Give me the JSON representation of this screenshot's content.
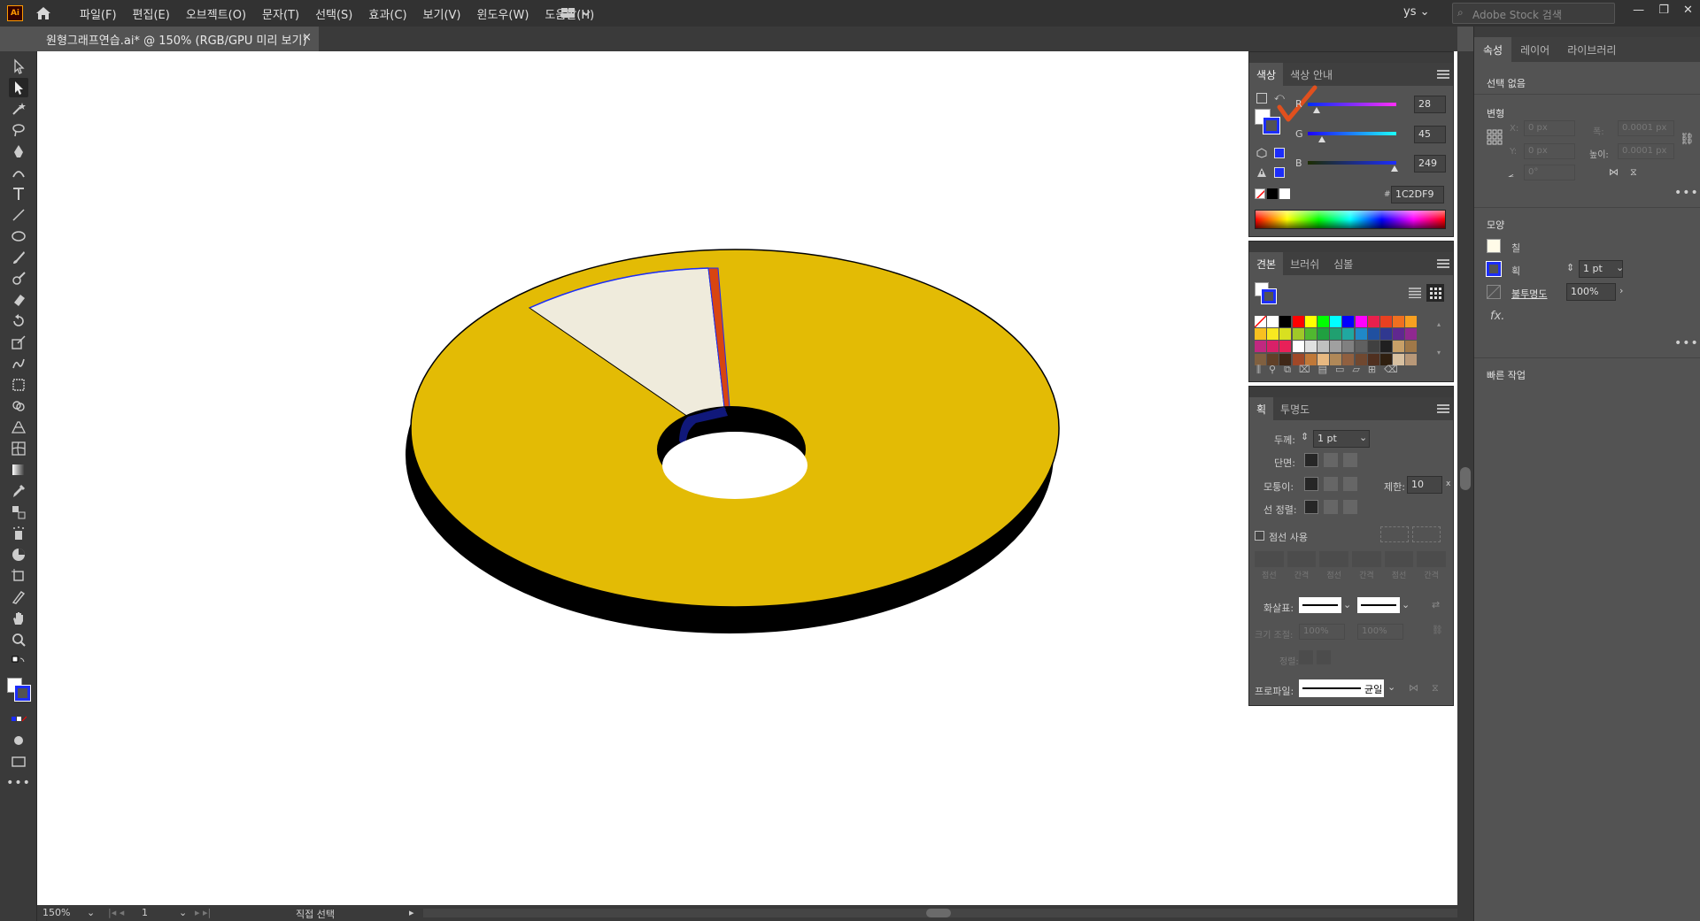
{
  "app": {
    "logo": "Ai",
    "menus": [
      "파일(F)",
      "편집(E)",
      "오브젝트(O)",
      "문자(T)",
      "선택(S)",
      "효과(C)",
      "보기(V)",
      "윈도우(W)",
      "도움말(H)"
    ],
    "user": "ys",
    "search_placeholder": "Adobe Stock 검색",
    "window_buttons": [
      "—",
      "❐",
      "✕"
    ]
  },
  "document_tab": {
    "title": "원형그래프연습.ai* @ 150% (RGB/GPU 미리 보기)",
    "close": "×"
  },
  "status_bar": {
    "zoom": "150%",
    "page": "1",
    "status": "직접 선택"
  },
  "color_panel": {
    "tabs": [
      "색상",
      "색상 안내"
    ],
    "channels": [
      {
        "label": "R",
        "value": "28"
      },
      {
        "label": "G",
        "value": "45"
      },
      {
        "label": "B",
        "value": "249"
      }
    ],
    "hex_label": "#",
    "hex": "1C2DF9",
    "annotation_color": "#e0501e"
  },
  "swatches_panel": {
    "tabs": [
      "견본",
      "브러쉬",
      "심볼"
    ],
    "colors": [
      "#ffffff",
      "#ffffff",
      "#000000",
      "#ff0000",
      "#ffff00",
      "#00ff00",
      "#00ffff",
      "#0000ff",
      "#ff00ff",
      "#e8204c",
      "#e84020",
      "#f07020",
      "#f8a020",
      "#f8c020",
      "#f8e820",
      "#d8e020",
      "#a0c828",
      "#50b830",
      "#20a040",
      "#20a070",
      "#20a8a0",
      "#2088c8",
      "#2050a0",
      "#303890",
      "#602890",
      "#902890",
      "#c02880",
      "#d82068",
      "#e82058",
      "#ffffff",
      "#e0e0e0",
      "#c0c0c0",
      "#a0a0a0",
      "#808080",
      "#606060",
      "#404040",
      "#202020",
      "#c8a068",
      "#a07848",
      "#806040",
      "#604028",
      "#402818",
      "#a04828",
      "#c07838",
      "#e8b880",
      "#b08858",
      "#906040",
      "#704830",
      "#503020",
      "#302010",
      "#d8c0a0",
      "#b89878"
    ]
  },
  "stroke_panel": {
    "tabs": [
      "획",
      "투명도"
    ],
    "weight_label": "두께:",
    "weight": "1 pt",
    "cap_label": "단면:",
    "corner_label": "모퉁이:",
    "limit_label": "제한:",
    "limit": "10",
    "limit_unit": "x",
    "align_label": "선 정렬:",
    "dashed_label": "점선 사용",
    "dash_fields": [
      "점선",
      "간격",
      "점선",
      "간격",
      "점선",
      "간격"
    ],
    "arrow_label": "화살표:",
    "scale_label": "크기 조절:",
    "scale_a": "100%",
    "scale_b": "100%",
    "align2_label": "정렬:",
    "profile_label": "프로파일:",
    "profile": "균일"
  },
  "properties_panel": {
    "tabs": [
      "속성",
      "레이어",
      "라이브러리"
    ],
    "no_selection": "선택 없음",
    "transform_title": "변형",
    "x_label": "X:",
    "x": "0 px",
    "y_label": "Y:",
    "y": "0 px",
    "w_label": "폭:",
    "w": "0.0001 px",
    "h_label": "높이:",
    "h": "0.0001 px",
    "angle": "0°",
    "appearance_title": "모양",
    "fill_label": "칠",
    "stroke_label": "획",
    "stroke_weight": "1 pt",
    "opacity_label": "불투명도",
    "opacity": "100%",
    "fx": "fx.",
    "quick_actions": "빠른 작업",
    "more": "•••"
  },
  "artwork": {
    "description_colors": {
      "main": "#e3bb05",
      "cream": "#efebdc",
      "orange": "#d84510",
      "navy": "#10187a",
      "shadow": "#000000",
      "stroke_highlight": "#1c2df9"
    }
  }
}
